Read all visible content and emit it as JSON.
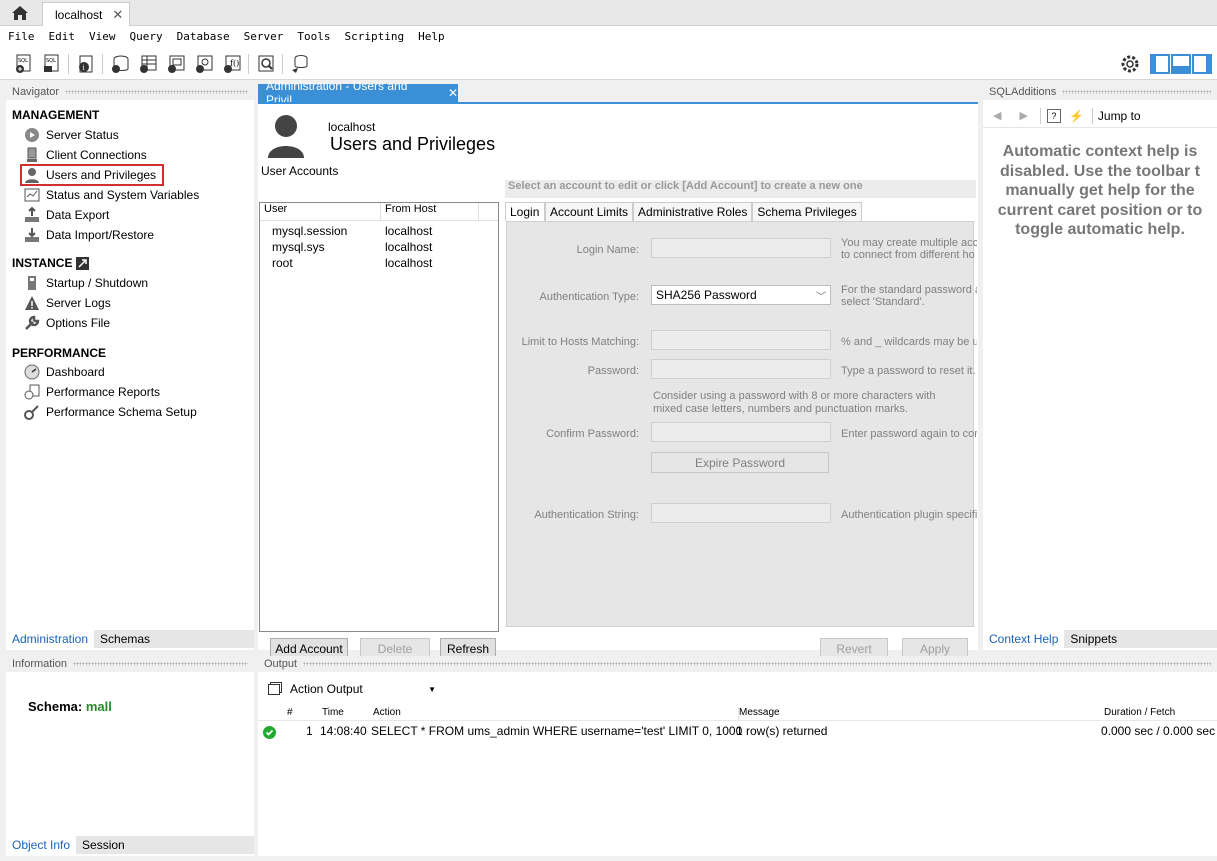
{
  "tabs": {
    "connection": "localhost"
  },
  "menu": [
    "File",
    "Edit",
    "View",
    "Query",
    "Database",
    "Server",
    "Tools",
    "Scripting",
    "Help"
  ],
  "navigator": {
    "title": "Navigator",
    "management_title": "MANAGEMENT",
    "management": [
      "Server Status",
      "Client Connections",
      "Users and Privileges",
      "Status and System Variables",
      "Data Export",
      "Data Import/Restore"
    ],
    "instance_title": "INSTANCE",
    "instance": [
      "Startup / Shutdown",
      "Server Logs",
      "Options File"
    ],
    "performance_title": "PERFORMANCE",
    "performance": [
      "Dashboard",
      "Performance Reports",
      "Performance Schema Setup"
    ],
    "bottom_tabs": [
      "Administration",
      "Schemas"
    ]
  },
  "document": {
    "tab_label": "Administration - Users and Privil...",
    "host": "localhost",
    "title": "Users and Privileges",
    "accounts_label": "User Accounts",
    "columns": [
      "User",
      "From Host"
    ],
    "accounts": [
      {
        "user": "mysql.session",
        "host": "localhost"
      },
      {
        "user": "mysql.sys",
        "host": "localhost"
      },
      {
        "user": "root",
        "host": "localhost"
      }
    ],
    "select_hint": "Select an account to edit or click [Add Account] to create a new one",
    "editor_tabs": [
      "Login",
      "Account Limits",
      "Administrative Roles",
      "Schema Privileges"
    ],
    "fields": {
      "login_name": "Login Name:",
      "login_hint": "You may create multiple acco\nto connect from different ho",
      "auth_type": "Authentication Type:",
      "auth_value": "SHA256 Password",
      "auth_hint": "For the standard password a\nselect 'Standard'.",
      "limit_hosts": "Limit to Hosts Matching:",
      "limit_hint": "% and _ wildcards may be u",
      "password": "Password:",
      "password_hint": "Type a password to reset it.",
      "password_advice": "Consider using a password with 8 or more characters with\nmixed case letters, numbers and punctuation marks.",
      "confirm": "Confirm Password:",
      "confirm_hint": "Enter password again to cor",
      "expire": "Expire Password",
      "auth_string": "Authentication String:",
      "auth_string_hint": "Authentication plugin specifi"
    },
    "buttons": {
      "add": "Add Account",
      "delete": "Delete",
      "refresh": "Refresh",
      "revert": "Revert",
      "apply": "Apply"
    }
  },
  "sqladditions": {
    "title": "SQLAdditions",
    "jump_to": "Jump to",
    "help_text": "Automatic context help is\ndisabled. Use the toolbar t\nmanually get help for the\ncurrent caret position or to\ntoggle automatic help.",
    "bottom_tabs": [
      "Context Help",
      "Snippets"
    ]
  },
  "information": {
    "title": "Information",
    "schema_label": "Schema:",
    "schema_value": "mall",
    "bottom_tabs": [
      "Object Info",
      "Session"
    ]
  },
  "output": {
    "title": "Output",
    "selector": "Action Output",
    "columns": [
      "#",
      "Time",
      "Action",
      "Message",
      "Duration / Fetch"
    ],
    "rows": [
      {
        "num": "1",
        "time": "14:08:40",
        "action": "SELECT * FROM ums_admin WHERE username='test' LIMIT 0, 1000",
        "message": "1 row(s) returned",
        "duration": "0.000 sec / 0.000 sec"
      }
    ]
  },
  "colors": {
    "accent": "#3b8fd6",
    "highlight": "#d03030",
    "schema": "#2a8a2a",
    "success": "#22aa33"
  }
}
